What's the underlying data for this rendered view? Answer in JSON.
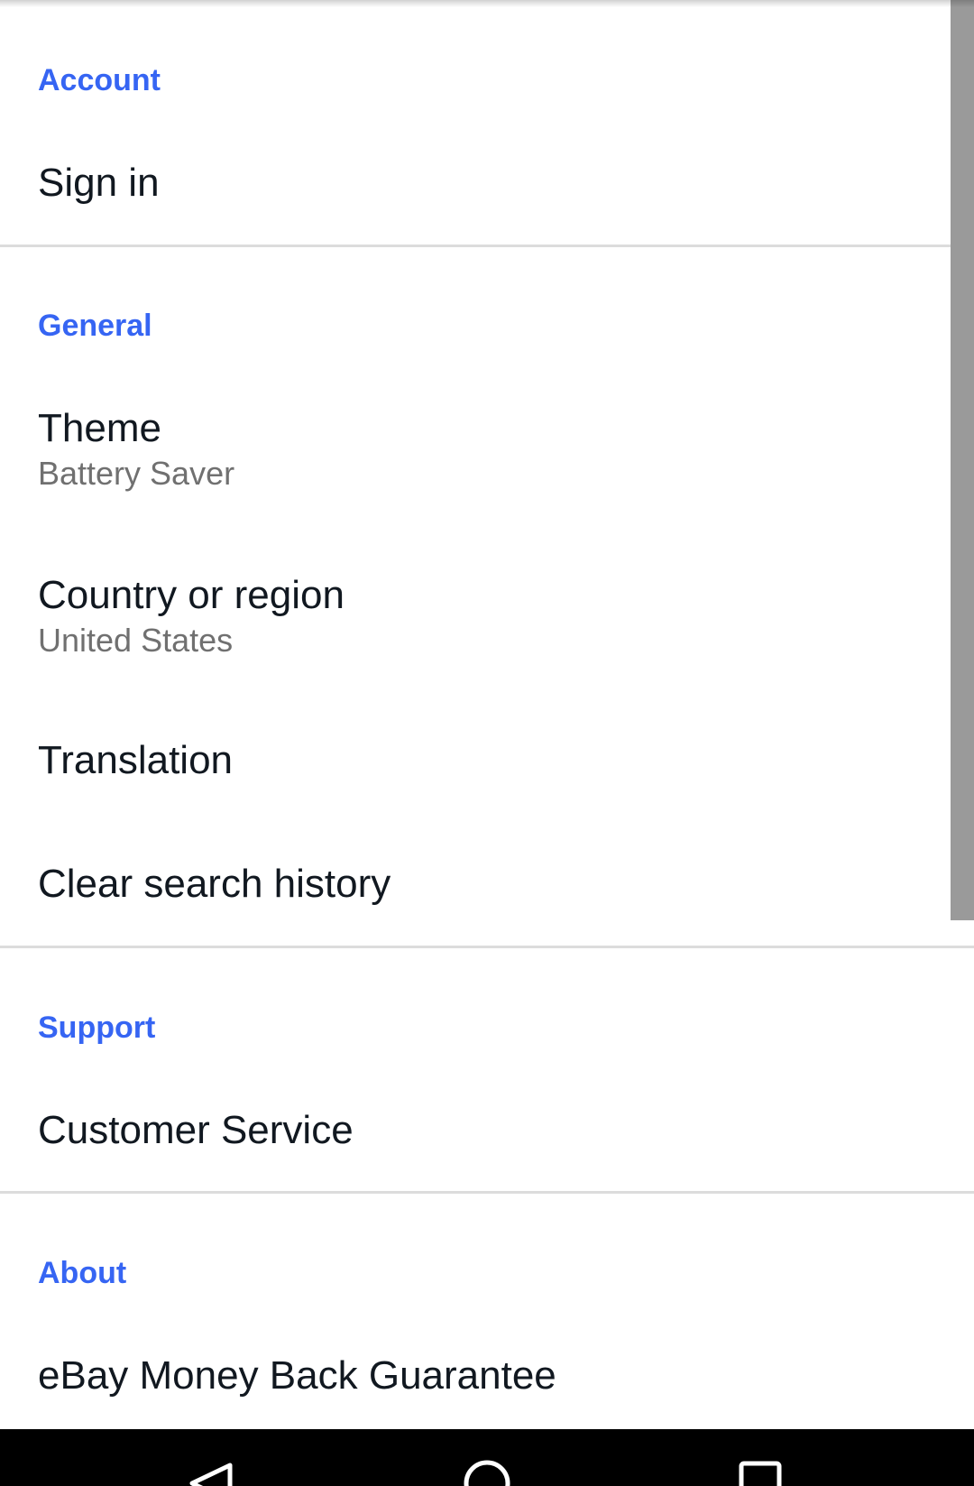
{
  "sections": {
    "account": {
      "header": "Account",
      "items": [
        {
          "title": "Sign in"
        }
      ]
    },
    "general": {
      "header": "General",
      "items": [
        {
          "title": "Theme",
          "subtitle": "Battery Saver"
        },
        {
          "title": "Country or region",
          "subtitle": "United States"
        },
        {
          "title": "Translation"
        },
        {
          "title": "Clear search history"
        }
      ]
    },
    "support": {
      "header": "Support",
      "items": [
        {
          "title": "Customer Service"
        }
      ]
    },
    "about": {
      "header": "About",
      "items": [
        {
          "title": "eBay Money Back Guarantee"
        }
      ]
    }
  },
  "nav_bar": {
    "back_icon": "triangle-back-icon",
    "home_icon": "circle-home-icon",
    "recents_icon": "square-recents-icon"
  },
  "colors": {
    "section_header": "#3665f3",
    "primary_text": "#111820",
    "secondary_text": "#707070",
    "divider": "#dcdcdc",
    "scrollbar": "#9a9a9a"
  }
}
